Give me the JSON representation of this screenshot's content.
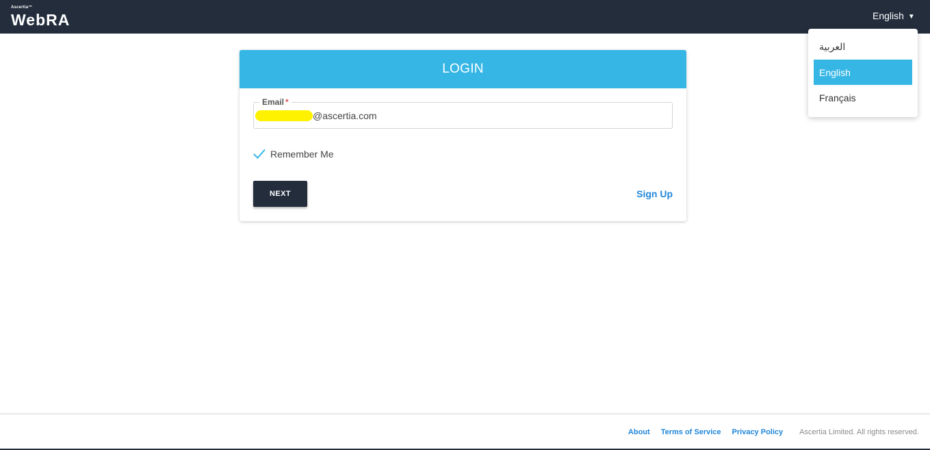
{
  "header": {
    "brand_small": "Ascertia™",
    "brand_main": "WebRA",
    "language_selected": "English",
    "language_caret": "▼"
  },
  "language_menu": {
    "items": [
      {
        "label": "العربية",
        "active": false
      },
      {
        "label": "English",
        "active": true
      },
      {
        "label": "Français",
        "active": false
      }
    ]
  },
  "login": {
    "title": "LOGIN",
    "email_label": "Email",
    "email_required_mark": "*",
    "email_value": "@ascertia.com",
    "remember_label": "Remember Me",
    "remember_checked": true,
    "next_label": "NEXT",
    "signup_label": "Sign Up"
  },
  "footer": {
    "about": "About",
    "terms": "Terms of Service",
    "privacy": "Privacy Policy",
    "copyright": "Ascertia Limited. All rights reserved."
  },
  "colors": {
    "header_bg": "#232d3c",
    "accent": "#36b6e5",
    "link": "#1f86d9"
  }
}
